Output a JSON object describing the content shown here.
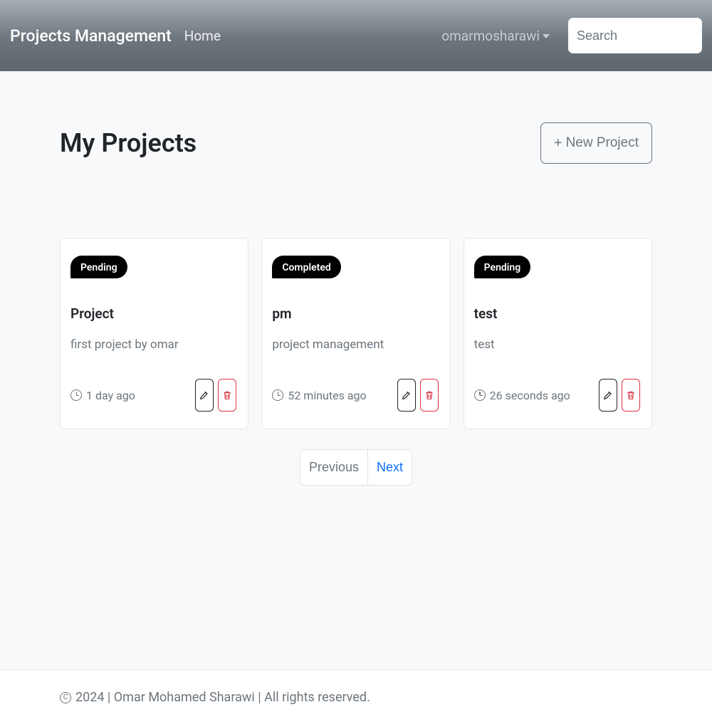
{
  "navbar": {
    "brand": "Projects Management",
    "home": "Home",
    "username": "omarmosharawi",
    "search_placeholder": "Search"
  },
  "header": {
    "title": "My Projects",
    "new_button": "New Project"
  },
  "projects": [
    {
      "status": "Pending",
      "title": "Project",
      "desc": "first project by omar",
      "time": "1 day ago"
    },
    {
      "status": "Completed",
      "title": "pm",
      "desc": "project management",
      "time": "52 minutes ago"
    },
    {
      "status": "Pending",
      "title": "test",
      "desc": "test",
      "time": "26 seconds ago"
    }
  ],
  "pagination": {
    "previous": "Previous",
    "next": "Next"
  },
  "footer": {
    "text": "2024 | Omar Mohamed Sharawi | All rights reserved."
  }
}
